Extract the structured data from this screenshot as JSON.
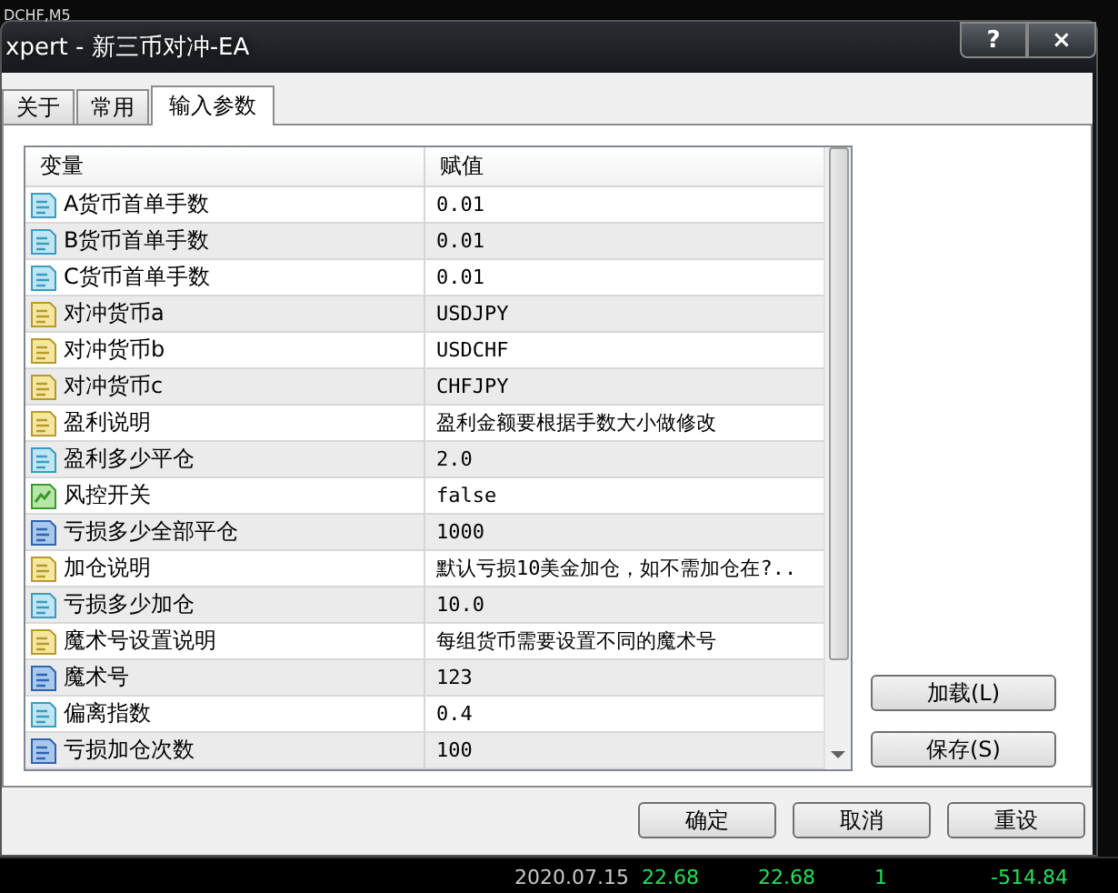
{
  "background": {
    "chart_label": "DCHF,M5",
    "bottom_row": [
      "2020.07.15",
      "22.68",
      "22.68",
      "1",
      "-514.84"
    ]
  },
  "window": {
    "title": "xpert - 新三币对冲-EA",
    "title_buttons": [
      "?",
      "×"
    ]
  },
  "tabs": [
    {
      "label": "关于",
      "selected": false
    },
    {
      "label": "常用",
      "selected": false
    },
    {
      "label": "输入参数",
      "selected": true
    }
  ],
  "table": {
    "columns": [
      "变量",
      "赋值"
    ],
    "rows": [
      {
        "kind": "double",
        "name": "A货币首单手数",
        "value": "0.01"
      },
      {
        "kind": "double",
        "name": "B货币首单手数",
        "value": "0.01"
      },
      {
        "kind": "double",
        "name": "C货币首单手数",
        "value": "0.01"
      },
      {
        "kind": "string",
        "name": "对冲货币a",
        "value": "USDJPY"
      },
      {
        "kind": "string",
        "name": "对冲货币b",
        "value": "USDCHF"
      },
      {
        "kind": "string",
        "name": "对冲货币c",
        "value": "CHFJPY"
      },
      {
        "kind": "string",
        "name": "盈利说明",
        "value": "盈利金额要根据手数大小做修改"
      },
      {
        "kind": "double",
        "name": "盈利多少平仓",
        "value": "2.0"
      },
      {
        "kind": "bool",
        "name": "风控开关",
        "value": "false"
      },
      {
        "kind": "int",
        "name": "亏损多少全部平仓",
        "value": "1000"
      },
      {
        "kind": "string",
        "name": "加仓说明",
        "value": "默认亏损10美金加仓，如不需加仓在?.."
      },
      {
        "kind": "double",
        "name": "亏损多少加仓",
        "value": "10.0"
      },
      {
        "kind": "string",
        "name": "魔术号设置说明",
        "value": "每组货币需要设置不同的魔术号"
      },
      {
        "kind": "int",
        "name": "魔术号",
        "value": "123"
      },
      {
        "kind": "double",
        "name": "偏离指数",
        "value": "0.4"
      },
      {
        "kind": "int",
        "name": "亏损加仓次数",
        "value": "100"
      }
    ]
  },
  "side_buttons": [
    "加载(L)",
    "保存(S)"
  ],
  "buttons": [
    "确定",
    "取消",
    "重设"
  ]
}
